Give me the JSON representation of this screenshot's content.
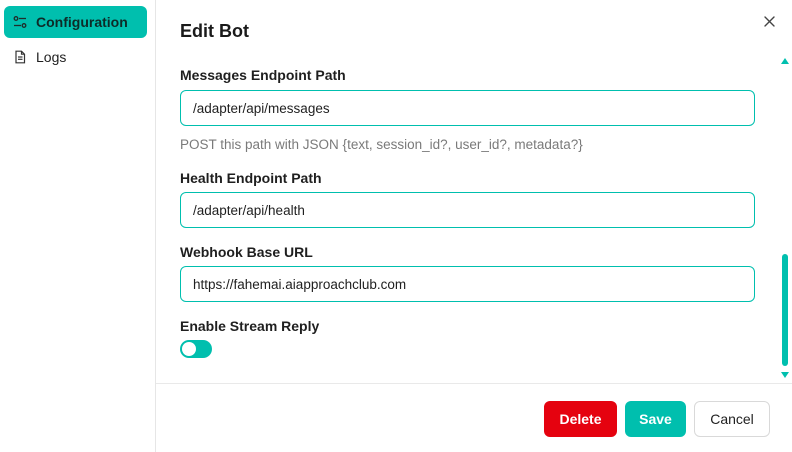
{
  "sidebar": {
    "items": [
      {
        "label": "Configuration",
        "icon": "sliders-icon",
        "active": true
      },
      {
        "label": "Logs",
        "icon": "document-icon",
        "active": false
      }
    ]
  },
  "modal": {
    "title": "Edit Bot",
    "close_icon": "close-icon"
  },
  "form": {
    "messages_endpoint": {
      "label": "Messages Endpoint Path",
      "value": "/adapter/api/messages",
      "hint": "POST this path with JSON {text, session_id?, user_id?, metadata?}"
    },
    "health_endpoint": {
      "label": "Health Endpoint Path",
      "value": "/adapter/api/health"
    },
    "webhook_base_url": {
      "label": "Webhook Base URL",
      "value": "https://fahemai.aiapproachclub.com"
    },
    "stream_reply": {
      "label": "Enable Stream Reply",
      "enabled": false
    }
  },
  "footer": {
    "delete_label": "Delete",
    "save_label": "Save",
    "cancel_label": "Cancel"
  },
  "colors": {
    "accent": "#00bfae",
    "danger": "#e5020f"
  }
}
